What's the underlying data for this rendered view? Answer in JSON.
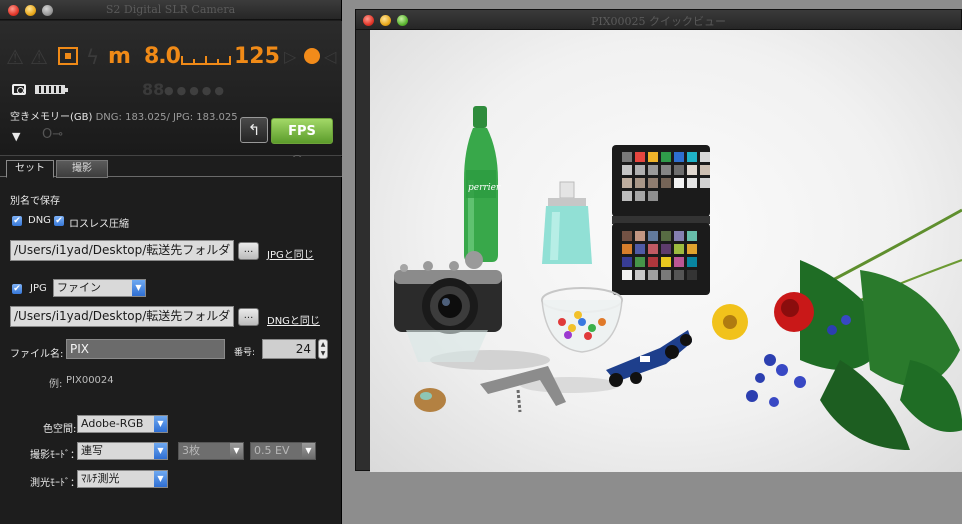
{
  "left_window": {
    "title": "S2 Digital SLR Camera",
    "lcd": {
      "metering_mode": "m",
      "aperture": "8.0",
      "frame_count": "88",
      "shutter": "125"
    },
    "memory": {
      "label": "空きメモリー(GB)",
      "values": "DNG: 183.025/ JPG: 183.025"
    },
    "fps_label": "FPS",
    "rotate_label": "↰",
    "tabs": [
      "セット",
      "撮影"
    ],
    "save_as_label": "別名で保存",
    "dng_label": "DNG",
    "lossless_label": "ロスレス圧縮",
    "dng_path": "/Users/i1yad/Desktop/転送先フォルダ",
    "browse_label": "...",
    "same_as_jpg": "JPGと同じ",
    "jpg_label": "JPG",
    "jpg_quality": "ファイン",
    "jpg_path": "/Users/i1yad/Desktop/転送先フォルダ",
    "same_as_dng": "DNGと同じ",
    "filename_label": "ファイル名:",
    "filename_value": "PIX",
    "number_label": "番号:",
    "number_value": "24",
    "example_label": "例:",
    "example_value": "PIX00024",
    "colorspace_label": "色空間:",
    "colorspace_value": "Adobe-RGB",
    "drive_label": "撮影ﾓｰﾄﾞ：",
    "drive_value": "連写",
    "burst_count": "3枚",
    "bracket_ev": "0.5 EV",
    "metering_label": "測光ﾓｰﾄﾞ：",
    "metering_value": "ﾏﾙﾁ測光"
  },
  "right_window": {
    "title": "PIX00025 クイックビュー"
  },
  "colors": {
    "accent_orange": "#f08a17",
    "fps_green": "#7fbf45",
    "select_blue": "#3677d8"
  }
}
